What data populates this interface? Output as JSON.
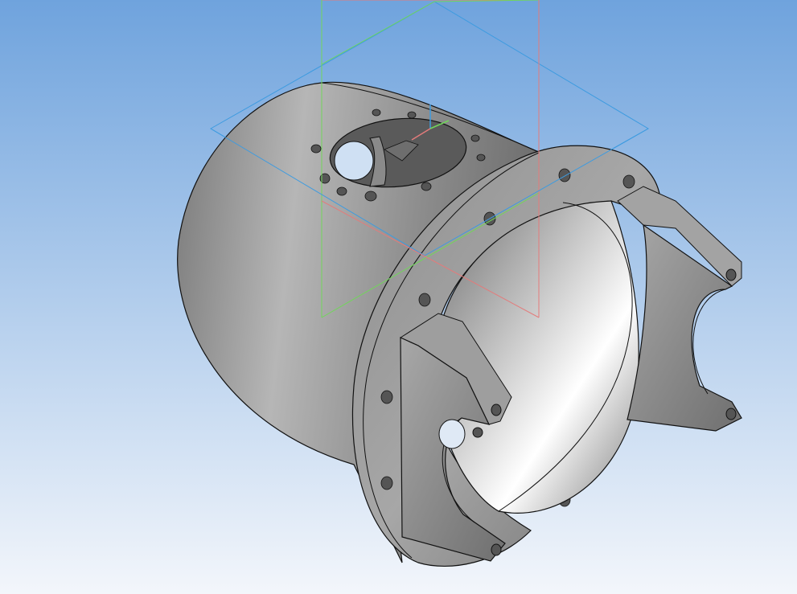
{
  "viewport": {
    "background_top": "#6fa3dd",
    "background_bottom": "#f3f6fb"
  },
  "planes": {
    "xy_color": "#3d9be0",
    "zx_color": "#e37b7b",
    "yz_color": "#71d65a"
  },
  "part": {
    "body_color": "#9b9b9b",
    "edge_color": "#111111",
    "hole_color": "#555555"
  }
}
